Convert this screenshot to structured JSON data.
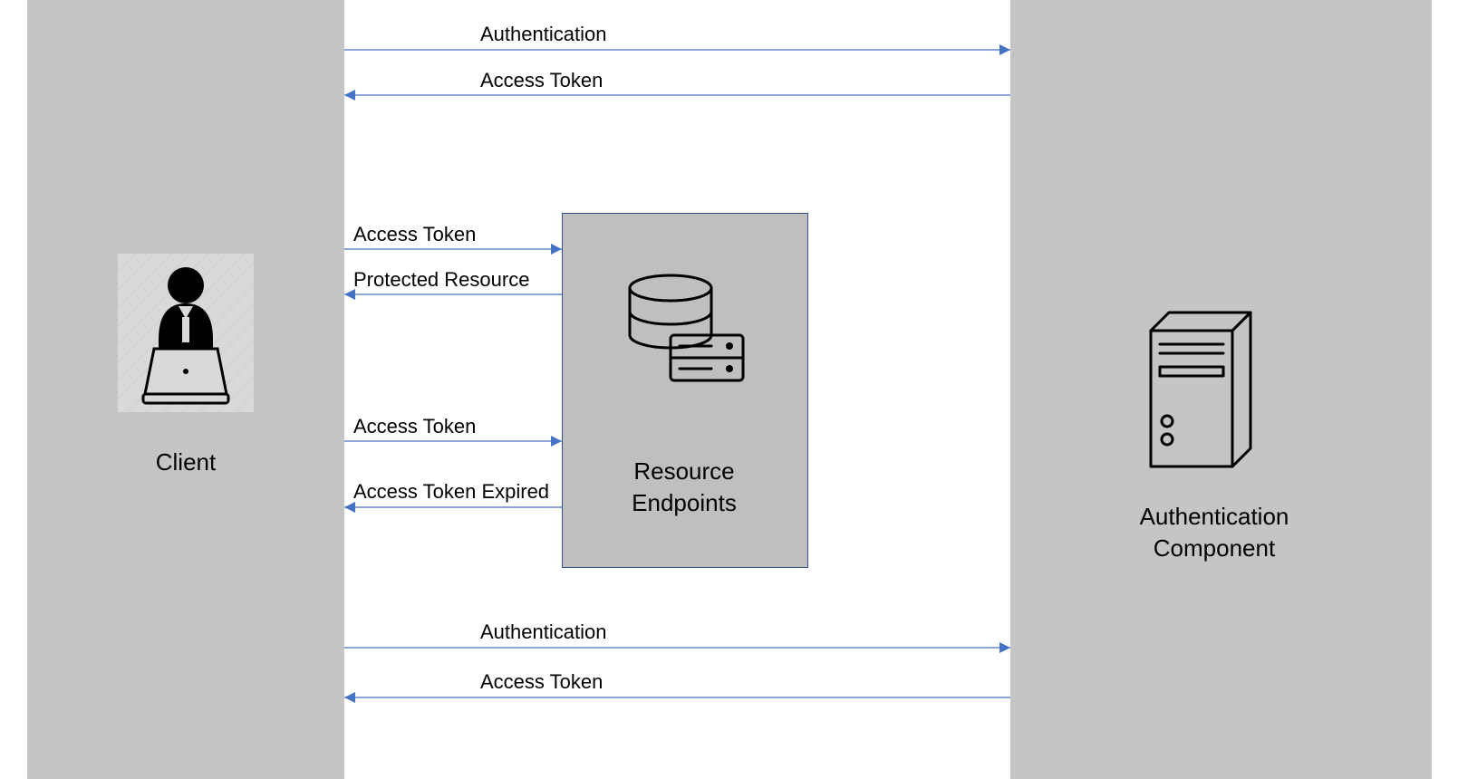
{
  "nodes": {
    "client": {
      "label": "Client"
    },
    "resource": {
      "label1": "Resource",
      "label2": "Endpoints"
    },
    "auth": {
      "label1": "Authentication",
      "label2": "Component"
    }
  },
  "arrows": {
    "a1": "Authentication",
    "a2": "Access Token",
    "a3": "Access Token",
    "a4": "Protected Resource",
    "a5": "Access Token",
    "a6": "Access Token Expired",
    "a7": "Authentication",
    "a8": "Access Token"
  }
}
